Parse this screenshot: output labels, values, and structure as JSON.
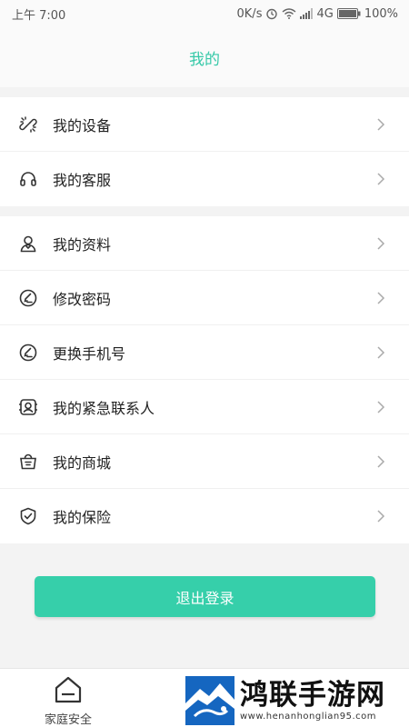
{
  "status_bar": {
    "time": "上午 7:00",
    "net_speed": "0K/s",
    "network": "4G",
    "battery": "100%"
  },
  "header": {
    "title": "我的"
  },
  "section1": {
    "items": [
      {
        "label": "我的设备",
        "icon": "device-link-icon"
      },
      {
        "label": "我的客服",
        "icon": "headset-icon"
      }
    ]
  },
  "section2": {
    "items": [
      {
        "label": "我的资料",
        "icon": "user-profile-icon"
      },
      {
        "label": "修改密码",
        "icon": "edit-circle-icon"
      },
      {
        "label": "更换手机号",
        "icon": "edit-circle-icon"
      },
      {
        "label": "我的紧急联系人",
        "icon": "emergency-contact-icon"
      },
      {
        "label": "我的商城",
        "icon": "shop-basket-icon"
      },
      {
        "label": "我的保险",
        "icon": "shield-check-icon"
      }
    ]
  },
  "logout": {
    "label": "退出登录"
  },
  "tab_bar": {
    "items": [
      {
        "label": "家庭安全",
        "icon": "home-icon"
      }
    ]
  },
  "watermark": {
    "title": "鸿联手游网",
    "url": "www.henanhonglian95.com"
  },
  "colors": {
    "accent": "#36c9a8",
    "button": "#36cfaa",
    "background": "#f3f3f3"
  }
}
